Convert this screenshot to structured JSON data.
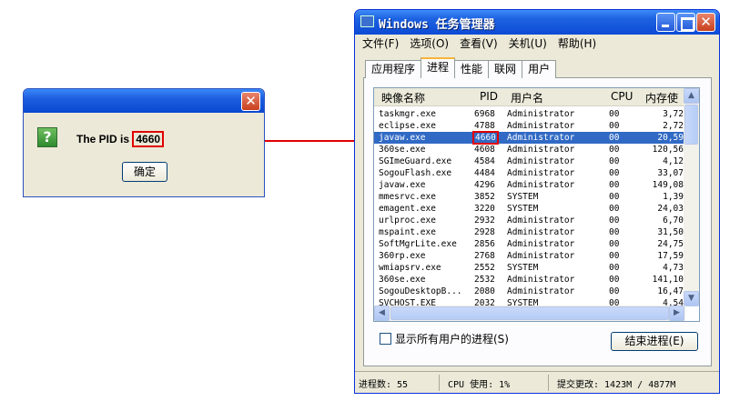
{
  "dialog": {
    "close_glyph": "✕",
    "icon_glyph": "?",
    "message_prefix": "The PID is ",
    "pid": "4660",
    "ok_label": "确定"
  },
  "taskmgr": {
    "title": "Windows 任务管理器",
    "menu": [
      "文件(F)",
      "选项(O)",
      "查看(V)",
      "关机(U)",
      "帮助(H)"
    ],
    "tabs": [
      "应用程序",
      "进程",
      "性能",
      "联网",
      "用户"
    ],
    "active_tab": 1,
    "columns": [
      "映像名称",
      "PID",
      "用户名",
      "CPU",
      "内存使"
    ],
    "rows": [
      {
        "name": "taskmgr.exe",
        "pid": "6968",
        "user": "Administrator",
        "cpu": "00",
        "mem": "3,72"
      },
      {
        "name": "eclipse.exe",
        "pid": "4788",
        "user": "Administrator",
        "cpu": "00",
        "mem": "2,72"
      },
      {
        "name": "javaw.exe",
        "pid": "4660",
        "user": "Administrator",
        "cpu": "00",
        "mem": "20,59",
        "selected": true
      },
      {
        "name": "360se.exe",
        "pid": "4608",
        "user": "Administrator",
        "cpu": "00",
        "mem": "120,56"
      },
      {
        "name": "SGImeGuard.exe",
        "pid": "4584",
        "user": "Administrator",
        "cpu": "00",
        "mem": "4,12"
      },
      {
        "name": "SogouFlash.exe",
        "pid": "4484",
        "user": "Administrator",
        "cpu": "00",
        "mem": "33,07"
      },
      {
        "name": "javaw.exe",
        "pid": "4296",
        "user": "Administrator",
        "cpu": "00",
        "mem": "149,08"
      },
      {
        "name": "mmesrvc.exe",
        "pid": "3852",
        "user": "SYSTEM",
        "cpu": "00",
        "mem": "1,39"
      },
      {
        "name": "emagent.exe",
        "pid": "3220",
        "user": "SYSTEM",
        "cpu": "00",
        "mem": "24,03"
      },
      {
        "name": "urlproc.exe",
        "pid": "2932",
        "user": "Administrator",
        "cpu": "00",
        "mem": "6,70"
      },
      {
        "name": "mspaint.exe",
        "pid": "2928",
        "user": "Administrator",
        "cpu": "00",
        "mem": "31,50"
      },
      {
        "name": "SoftMgrLite.exe",
        "pid": "2856",
        "user": "Administrator",
        "cpu": "00",
        "mem": "24,75"
      },
      {
        "name": "360rp.exe",
        "pid": "2768",
        "user": "Administrator",
        "cpu": "00",
        "mem": "17,59"
      },
      {
        "name": "wmiapsrv.exe",
        "pid": "2552",
        "user": "SYSTEM",
        "cpu": "00",
        "mem": "4,73"
      },
      {
        "name": "360se.exe",
        "pid": "2532",
        "user": "Administrator",
        "cpu": "00",
        "mem": "141,10"
      },
      {
        "name": "SogouDesktopB...",
        "pid": "2080",
        "user": "Administrator",
        "cpu": "00",
        "mem": "16,47"
      },
      {
        "name": "SVCHOST.EXE",
        "pid": "2032",
        "user": "SYSTEM",
        "cpu": "00",
        "mem": "4,54"
      }
    ],
    "show_all_label": "显示所有用户的进程(S)",
    "end_process_label": "结束进程(E)",
    "status": {
      "processes": "进程数: 55",
      "cpu": "CPU 使用: 1%",
      "commit": "提交更改: 1423M / 4877M"
    }
  },
  "colors": {
    "highlight_red": "#e00000",
    "selection_blue": "#316ac5",
    "titlebar_blue": "#0b4ad5"
  }
}
